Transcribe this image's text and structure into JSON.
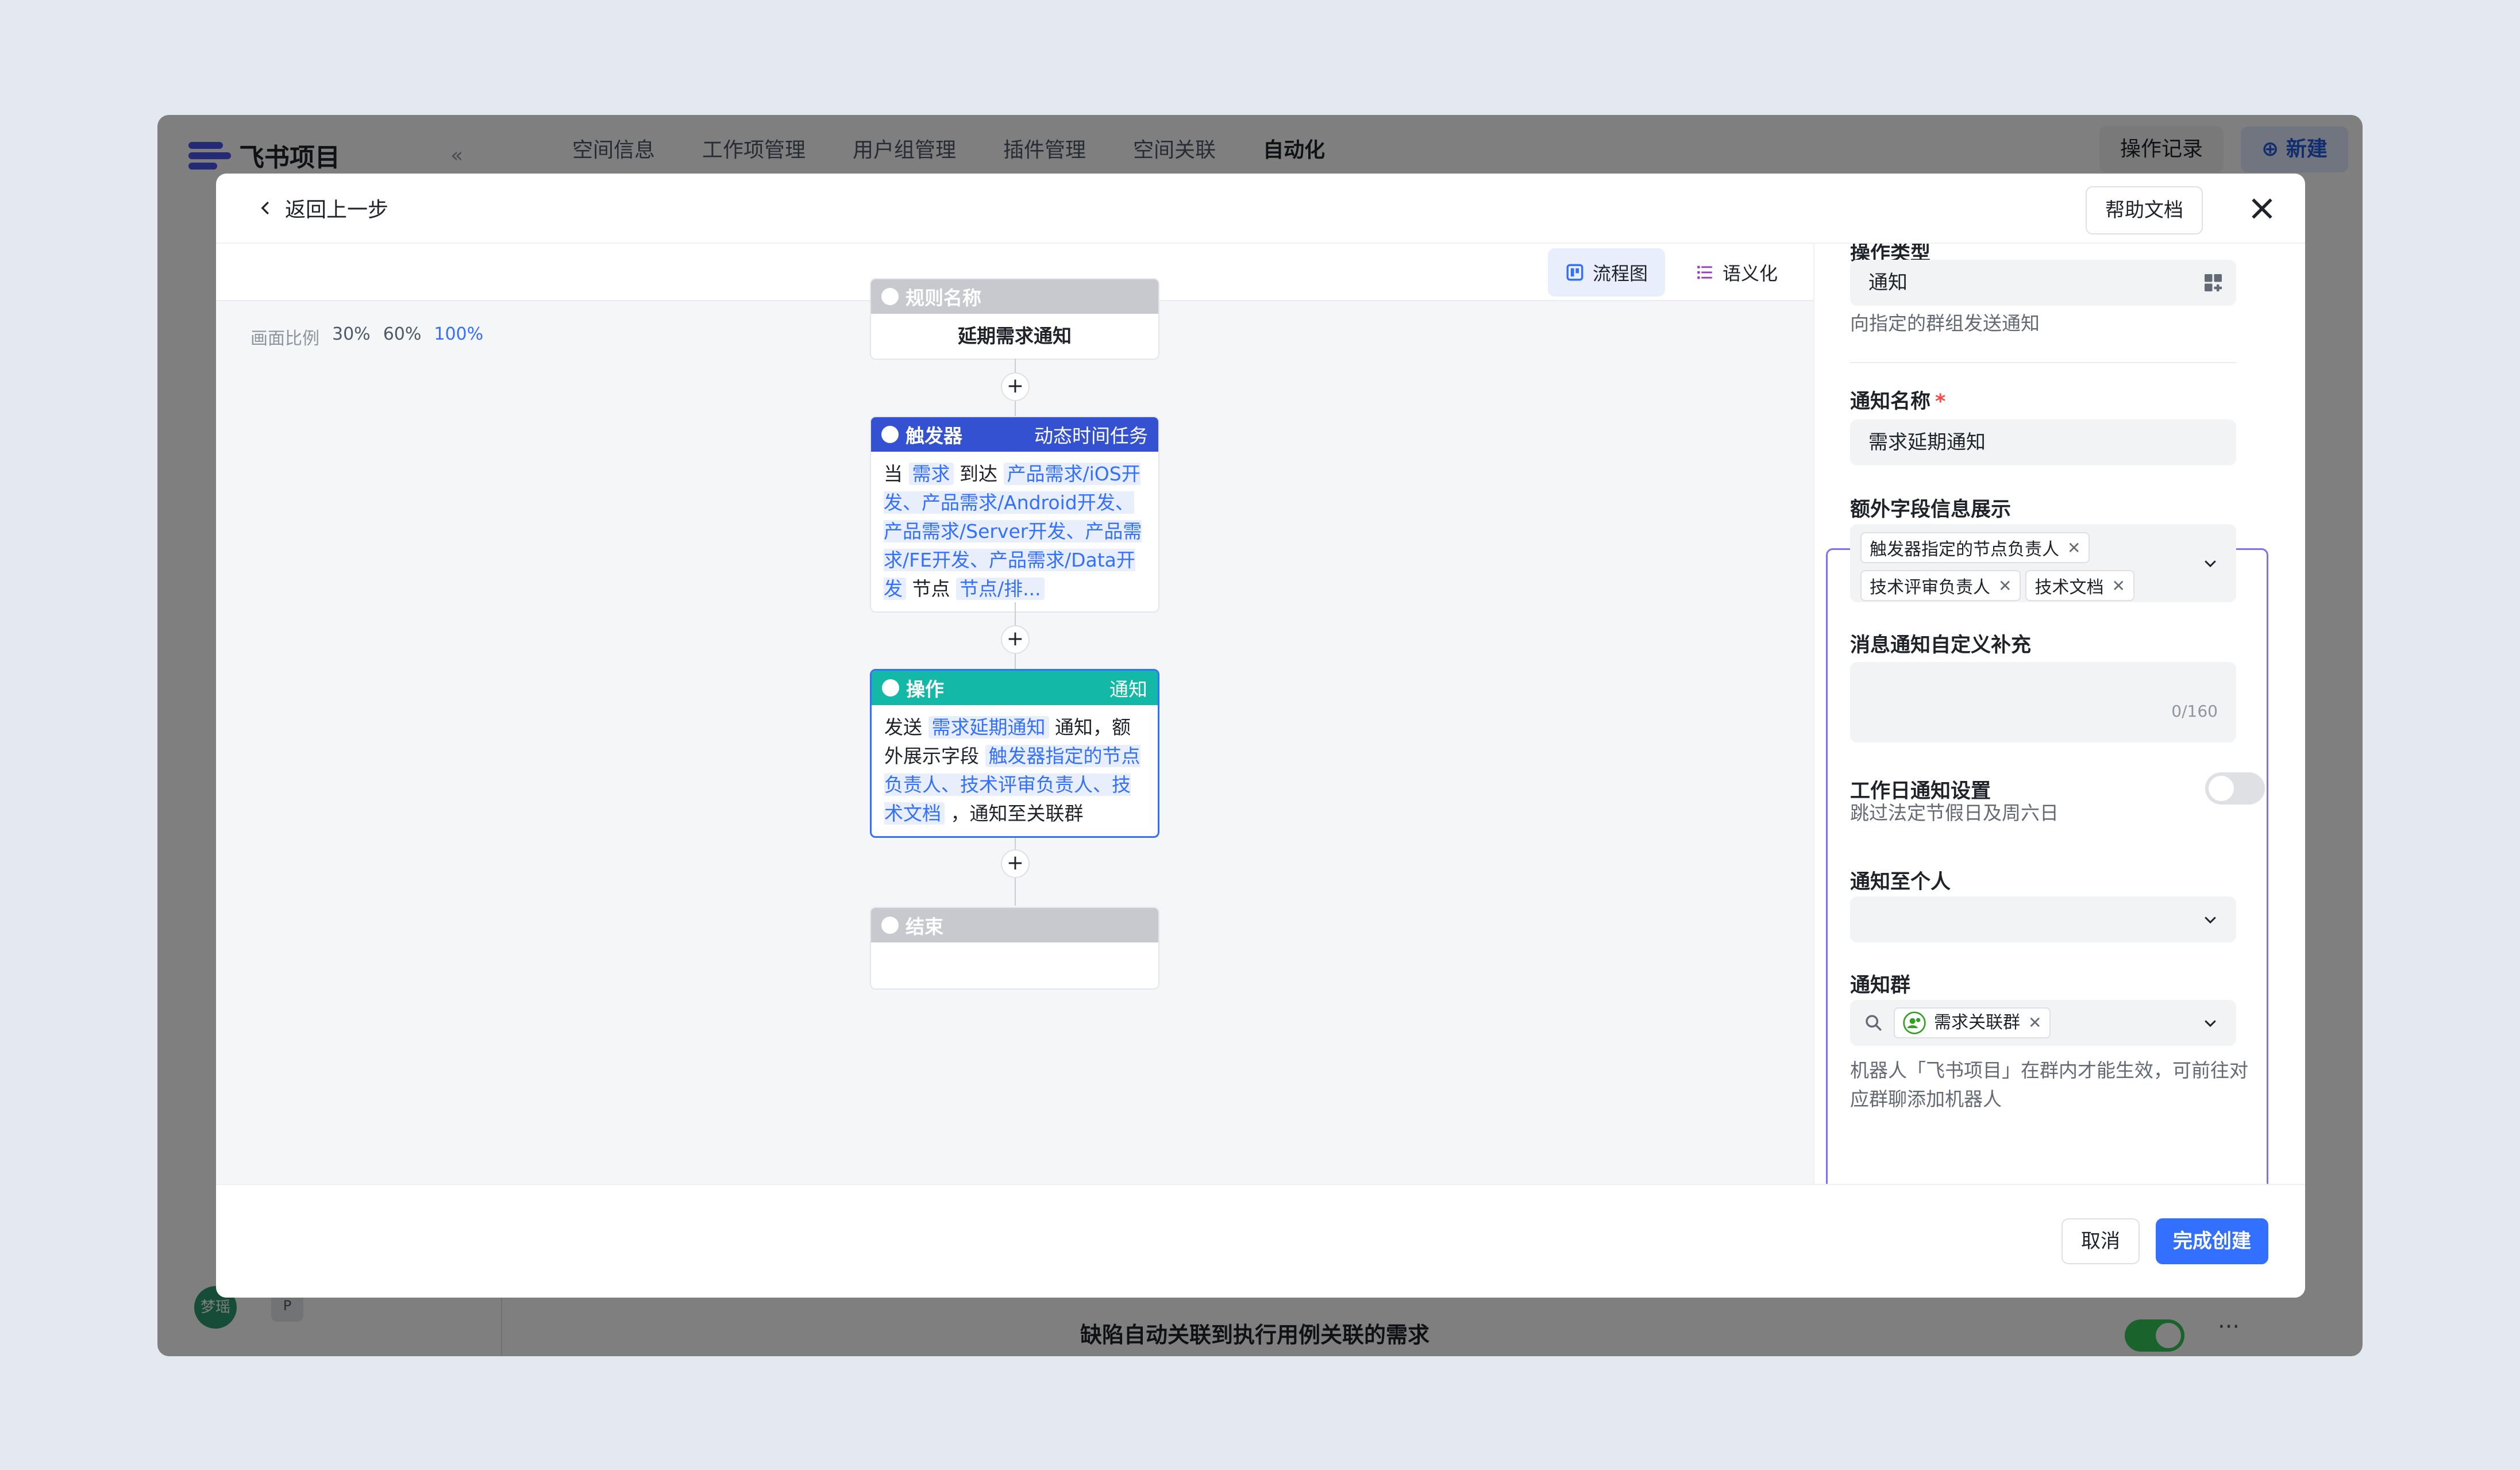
{
  "app": {
    "logo_text": "飞书项目",
    "collapse_icon": "«",
    "nav_tabs": [
      "空间信息",
      "工作项管理",
      "用户组管理",
      "插件管理",
      "空间关联",
      "自动化"
    ],
    "active_tab": "自动化",
    "op_log": "操作记录",
    "new_button": "新建",
    "bg_row_title": "缺陷自动关联到执行用例关联的需求",
    "avatar_text": "梦瑶",
    "p_badge": "P"
  },
  "modal": {
    "back_label": "返回上一步",
    "help_label": "帮助文档",
    "view_flow": "流程图",
    "view_semantic": "语义化",
    "zoom": {
      "label": "画面比例",
      "options": [
        "30%",
        "60%",
        "100%"
      ],
      "active": "100%"
    },
    "nodes": {
      "rule": {
        "header": "规则名称",
        "name": "延期需求通知"
      },
      "trigger": {
        "header": "触发器",
        "type": "动态时间任务",
        "when": "当",
        "item": "需求",
        "arrive": "到达",
        "nodes_list": "产品需求/iOS开发、产品需求/Android开发、产品需求/Server开发、产品需求/FE开发、产品需求/Data开发",
        "node_word": "节点",
        "more": "节点/排..."
      },
      "action": {
        "header": "操作",
        "type": "通知",
        "send": "发送",
        "notif_name": "需求延期通知",
        "middle": "通知，额外展示字段",
        "fields": "触发器指定的节点负责人、技术评审负责人、技术文档",
        "tail": "，通知至关联群"
      },
      "end": {
        "header": "结束"
      }
    },
    "panel": {
      "action_type_label": "操作类型",
      "action_type_value": "通知",
      "action_type_hint": "向指定的群组发送通知",
      "name_label": "通知名称",
      "name_value": "需求延期通知",
      "extra_label": "额外字段信息展示",
      "extra_tags": [
        "触发器指定的节点负责人",
        "技术评审负责人",
        "技术文档"
      ],
      "custom_label": "消息通知自定义补充",
      "custom_counter": "0/160",
      "workday_label": "工作日通知设置",
      "workday_hint": "跳过法定节假日及周六日",
      "workday_enabled": false,
      "person_label": "通知至个人",
      "group_label": "通知群",
      "group_tag": "需求关联群",
      "group_hint": "机器人「飞书项目」在群内才能生效，可前往对应群聊添加机器人"
    },
    "cancel_label": "取消",
    "done_label": "完成创建"
  },
  "colors": {
    "primary": "#3370ff",
    "trigger_header": "#3451d1",
    "action_header": "#14b8a6",
    "rule_header": "#c7c9ce",
    "focus_border": "#7d71f5"
  }
}
